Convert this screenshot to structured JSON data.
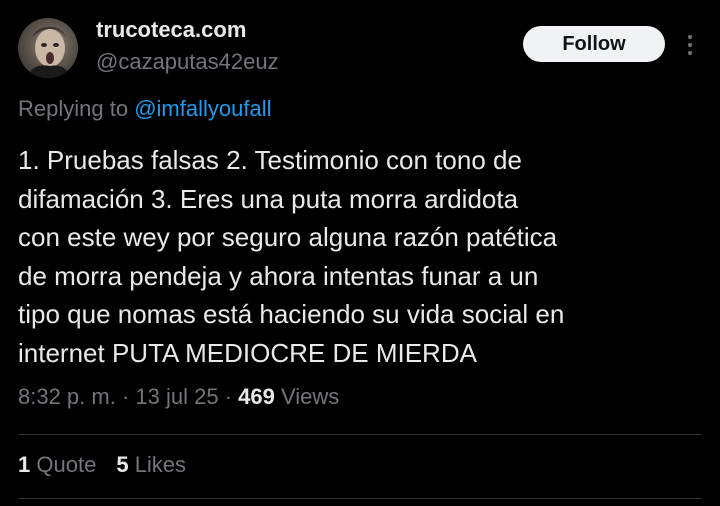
{
  "author": {
    "display_name": "trucoteca.com",
    "handle": "@cazaputas42euz"
  },
  "follow_button": {
    "label": "Follow"
  },
  "more_menu": {
    "icon": "more-vertical-icon"
  },
  "reply_context": {
    "prefix": "Replying to",
    "mention": "@imfallyoufall"
  },
  "tweet_text": {
    "lines": [
      "1. Pruebas falsas 2. Testimonio con tono de",
      "difamación 3. Eres una puta morra ardidota",
      "con este wey por seguro alguna razón patética",
      "de morra pendeja y ahora intentas funar a un",
      "tipo que nomas está haciendo su vida social en",
      "internet PUTA MEDIOCRE DE MIERDA"
    ]
  },
  "meta": {
    "time": "8:32 p. m.",
    "separator": " · ",
    "date": "13 jul 25",
    "views_count": "469",
    "views_label": "Views"
  },
  "stats": {
    "quotes_count": "1",
    "quotes_label": "Quote",
    "likes_count": "5",
    "likes_label": "Likes"
  },
  "colors": {
    "background": "#000000",
    "primary_text": "#e7e9ea",
    "secondary_text": "#71767b",
    "link": "#1d9bf0",
    "follow_bg": "#eff3f4",
    "divider": "#2f3336"
  }
}
